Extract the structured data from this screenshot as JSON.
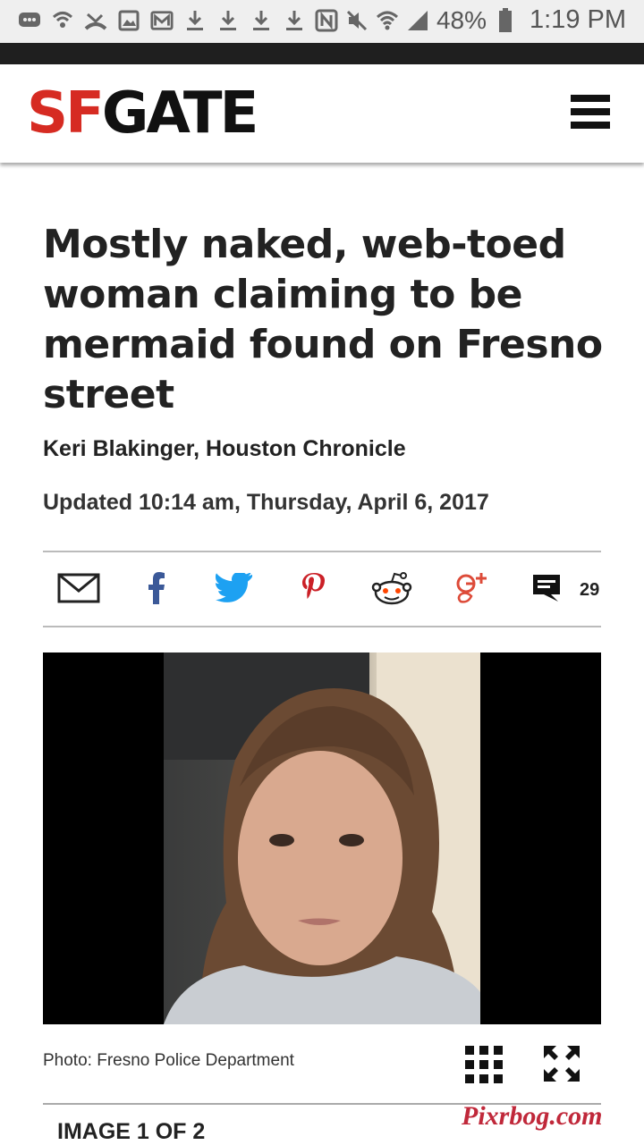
{
  "status_bar": {
    "battery": "48%",
    "time": "1:19 PM"
  },
  "site": {
    "logo_sf": "SF",
    "logo_gate": "GATE"
  },
  "article": {
    "headline": "Mostly naked, web-toed woman claiming to be mermaid found on Fresno street",
    "byline": "Keri Blakinger, Houston Chronicle",
    "updated": "Updated 10:14 am, Thursday, April 6, 2017"
  },
  "share": {
    "comment_count": "29",
    "icons": [
      "email-icon",
      "facebook-icon",
      "twitter-icon",
      "pinterest-icon",
      "reddit-icon",
      "google-plus-icon",
      "comment-icon"
    ]
  },
  "gallery": {
    "caption": "Photo: Fresno Police Department",
    "counter": "IMAGE 1 OF 2"
  },
  "watermark": "Pixrbog.com",
  "colors": {
    "brand_red": "#d62b22",
    "facebook": "#3b5998",
    "twitter": "#1da1f2",
    "pinterest": "#cb2027",
    "google_plus": "#dd4b39"
  }
}
